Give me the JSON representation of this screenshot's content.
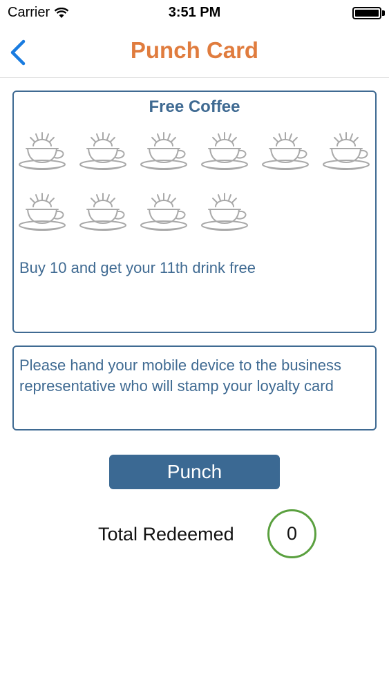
{
  "status_bar": {
    "carrier": "Carrier",
    "time": "3:51 PM"
  },
  "nav": {
    "title": "Punch Card"
  },
  "card": {
    "title": "Free Coffee",
    "description": "Buy 10 and get your 11th drink free",
    "stamps_total": 10,
    "stamps_punched": 0
  },
  "instructions": {
    "text": "Please hand your mobile device to the business representative who will stamp your loyalty card"
  },
  "actions": {
    "punch_label": "Punch"
  },
  "redeemed": {
    "label": "Total Redeemed",
    "count": "0"
  },
  "colors": {
    "accent_orange": "#e07c3e",
    "primary_blue": "#3f6a92",
    "ring_green": "#5aa03f",
    "back_blue": "#1a7ce0"
  }
}
